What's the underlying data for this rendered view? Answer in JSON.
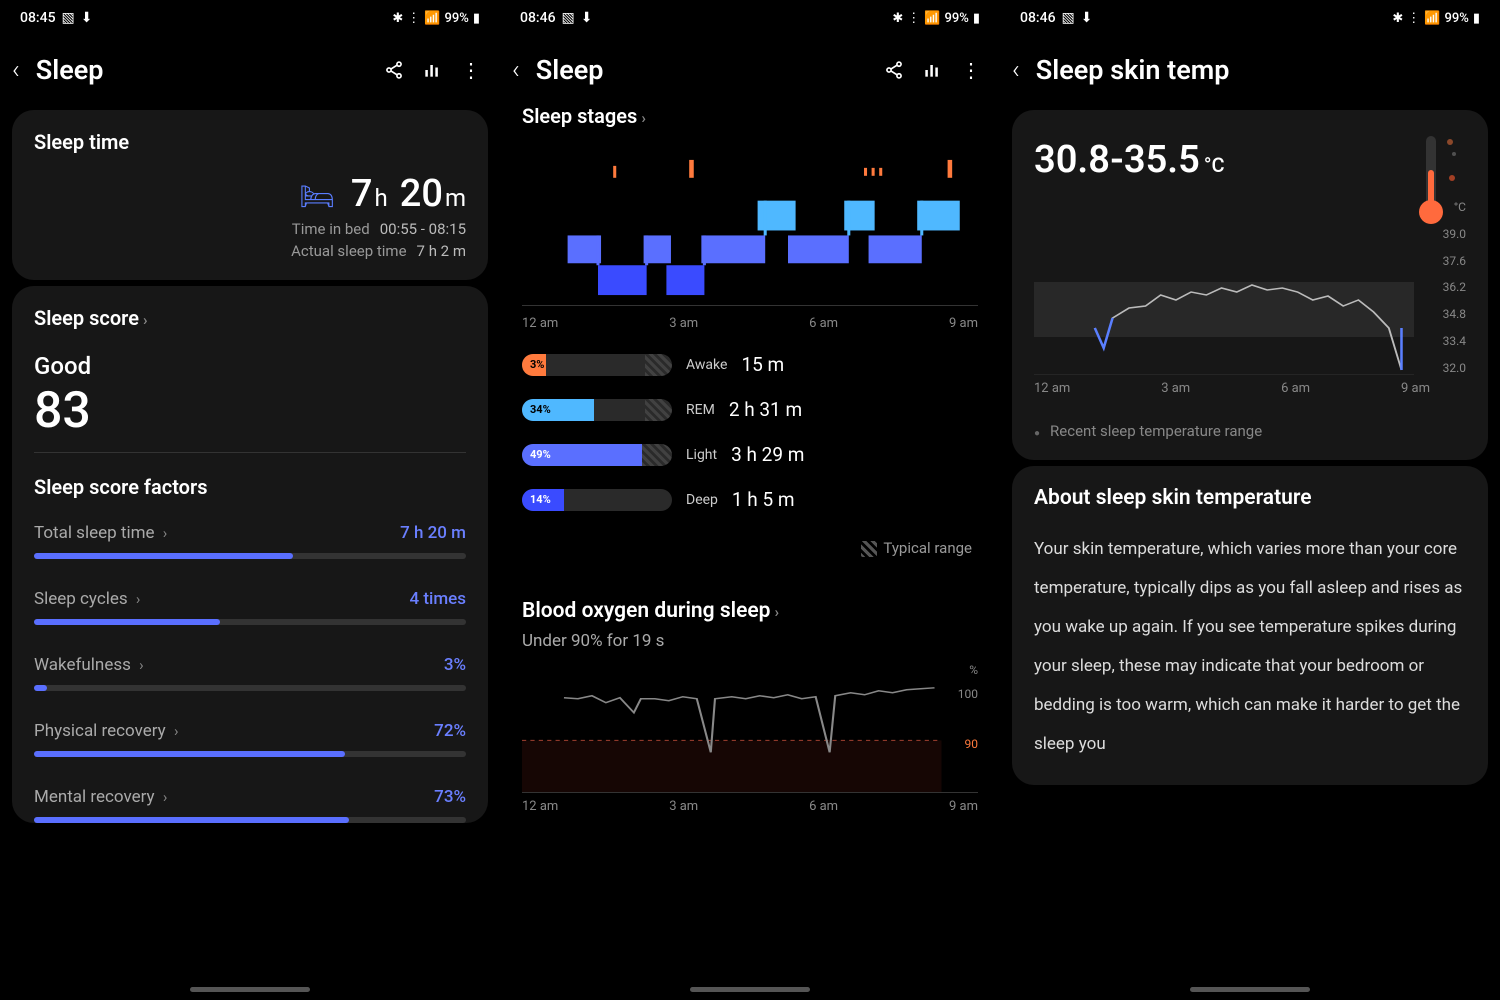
{
  "status": {
    "time1": "08:45",
    "time2": "08:46",
    "time3": "08:46",
    "battery": "99%"
  },
  "screen1": {
    "title": "Sleep",
    "card_time": {
      "title": "Sleep time",
      "hours": "7",
      "h": "h",
      "mins": "20",
      "m": "m",
      "bed_label": "Time in bed",
      "bed_val": "00:55 - 08:15",
      "actual_label": "Actual sleep time",
      "actual_val": "7 h 2 m"
    },
    "card_score": {
      "title": "Sleep score",
      "grade": "Good",
      "value": "83",
      "factors_title": "Sleep score factors",
      "factors": [
        {
          "label": "Total sleep time",
          "val": "7 h 20 m",
          "pct": 60
        },
        {
          "label": "Sleep cycles",
          "val": "4 times",
          "pct": 43
        },
        {
          "label": "Wakefulness",
          "val": "3%",
          "pct": 3
        },
        {
          "label": "Physical recovery",
          "val": "72%",
          "pct": 72
        },
        {
          "label": "Mental recovery",
          "val": "73%",
          "pct": 73
        }
      ]
    }
  },
  "screen2": {
    "title": "Sleep",
    "stages_title": "Sleep stages",
    "xaxis": [
      "12 am",
      "3 am",
      "6 am",
      "9 am"
    ],
    "stages": [
      {
        "name": "Awake",
        "pct": "3%",
        "val": "15 m",
        "color": "#ff7a3d",
        "fill": 16,
        "hatch": 18
      },
      {
        "name": "REM",
        "pct": "34%",
        "val": "2 h 31 m",
        "color": "#4fb8ff",
        "fill": 48,
        "hatch": 18
      },
      {
        "name": "Light",
        "pct": "49%",
        "val": "3 h 29 m",
        "color": "#5a6fff",
        "fill": 80,
        "hatch": 20
      },
      {
        "name": "Deep",
        "pct": "14%",
        "val": "1 h 5 m",
        "color": "#3a4bff",
        "fill": 28,
        "hatch": 0
      }
    ],
    "typical_label": "Typical range",
    "spo2_title": "Blood oxygen during sleep",
    "spo2_sub": "Under 90% for 19 s",
    "spo2_yaxis": [
      "%",
      "100",
      "90"
    ]
  },
  "screen3": {
    "title": "Sleep skin temp",
    "range_low": "30.8",
    "range_sep": " - ",
    "range_high": "35.5",
    "unit": "°C",
    "yaxis_unit": "°C",
    "yaxis": [
      "39.0",
      "37.6",
      "36.2",
      "34.8",
      "33.4",
      "32.0"
    ],
    "xaxis": [
      "12 am",
      "3 am",
      "6 am",
      "9 am"
    ],
    "legend": "Recent sleep temperature range",
    "about_title": "About sleep skin temperature",
    "about_text": "Your skin temperature, which varies more than your core temperature, typically dips as you fall asleep and rises as you wake up again. If you see temperature spikes during your sleep, these may indicate that your bedroom or bedding is too warm, which can make it harder to get the sleep you"
  },
  "chart_data": [
    {
      "type": "bar",
      "title": "Sleep stages breakdown",
      "categories": [
        "Awake",
        "REM",
        "Light",
        "Deep"
      ],
      "values_pct": [
        3,
        34,
        49,
        14
      ],
      "values_label": [
        "15 m",
        "2 h 31 m",
        "3 h 29 m",
        "1 h 5 m"
      ],
      "xaxis_time": [
        "12 am",
        "3 am",
        "6 am",
        "9 am"
      ]
    },
    {
      "type": "line",
      "title": "Blood oxygen during sleep",
      "ylabel": "%",
      "ylim": [
        85,
        100
      ],
      "threshold": 90,
      "note": "Under 90% for 19 s",
      "xaxis": [
        "12 am",
        "3 am",
        "6 am",
        "9 am"
      ],
      "approx_values": [
        96,
        96,
        95,
        96,
        93,
        96,
        96,
        95,
        96,
        88,
        96,
        96,
        97,
        96,
        97,
        90,
        97,
        97,
        97,
        98
      ]
    },
    {
      "type": "line",
      "title": "Sleep skin temperature",
      "ylabel": "°C",
      "ylim": [
        32.0,
        39.0
      ],
      "xaxis": [
        "12 am",
        "3 am",
        "6 am",
        "9 am"
      ],
      "approx_values": [
        33.0,
        32.2,
        34.2,
        34.6,
        34.7,
        35.2,
        35.0,
        35.3,
        35.2,
        35.4,
        35.5,
        35.3,
        35.4,
        35.0,
        35.1,
        34.6,
        34.8,
        34.4,
        33.4,
        31.5
      ],
      "range_summary": "30.8 - 35.5 °C"
    }
  ]
}
